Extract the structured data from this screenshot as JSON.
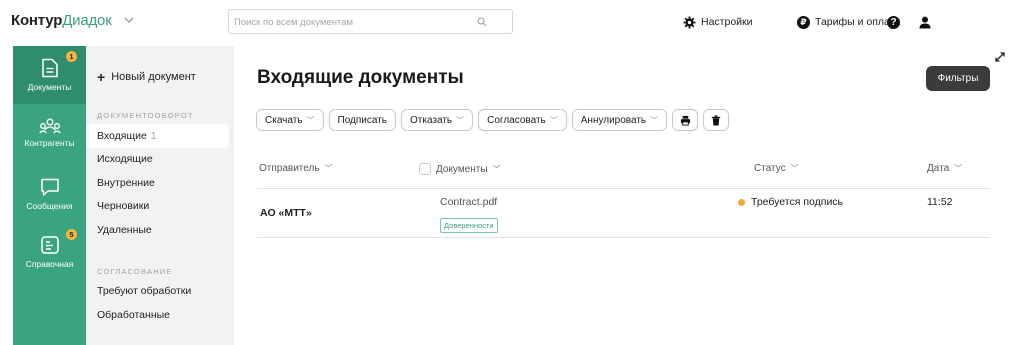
{
  "app": {
    "logo_bold": "Контур",
    "logo_light": "Диадок"
  },
  "search": {
    "placeholder": "Поиск по всем документам"
  },
  "topbar": {
    "settings_label": "Настройки",
    "tariffs_label": "Тарифы и оплата",
    "rub_glyph": "₽",
    "help_glyph": "?"
  },
  "rail": {
    "items": [
      {
        "label": "Документы",
        "icon": "document-icon",
        "badge": "1"
      },
      {
        "label": "Контрагенты",
        "icon": "users-icon"
      },
      {
        "label": "Сообщения",
        "icon": "chat-icon"
      },
      {
        "label": "Справочная",
        "icon": "help-doc-icon",
        "badge": "5"
      }
    ]
  },
  "nav": {
    "new_document": "Новый документ",
    "section_docflow": "ДОКУМЕНТООБОРОТ",
    "docflow_items": [
      {
        "label": "Входящие",
        "count": "1"
      },
      {
        "label": "Исходящие"
      },
      {
        "label": "Внутренние"
      },
      {
        "label": "Черновики"
      },
      {
        "label": "Удаленные"
      }
    ],
    "section_approval": "СОГЛАСОВАНИЕ",
    "approval_items": [
      {
        "label": "Требуют обработки"
      },
      {
        "label": "Обработанные"
      }
    ]
  },
  "main": {
    "title": "Входящие документы",
    "filters_label": "Фильтры",
    "actions": {
      "download": "Скачать",
      "sign": "Подписать",
      "reject": "Отказать",
      "approve": "Согласовать",
      "cancel": "Аннулировать"
    },
    "columns": {
      "sender": "Отправитель",
      "documents": "Документы",
      "status": "Статус",
      "date": "Дата"
    },
    "rows": [
      {
        "sender": "АО «МТТ»",
        "document": "Contract.pdf",
        "tag": "Доверенности",
        "status": "Требуется подпись",
        "date": "11:52"
      }
    ]
  },
  "colors": {
    "brand_green": "#3aa480",
    "rail_active": "#2f8d6c",
    "badge": "#f5b63d",
    "status_pending": "#f0a93a"
  }
}
